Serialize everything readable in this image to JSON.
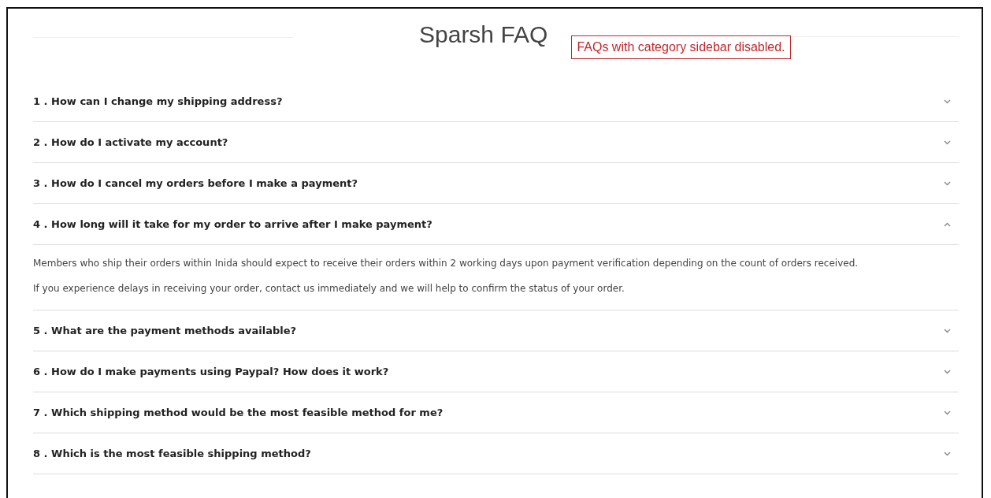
{
  "title": "Sparsh FAQ",
  "annotation": "FAQs with category sidebar disabled.",
  "faqs": [
    {
      "question": "1 . How can I change my shipping address?",
      "expanded": false
    },
    {
      "question": "2 . How do I activate my account?",
      "expanded": false
    },
    {
      "question": "3 . How do I cancel my orders before I make a payment?",
      "expanded": false
    },
    {
      "question": "4 . How long will it take for my order to arrive after I make payment?",
      "expanded": true,
      "answer": [
        "Members who ship their orders within Inida should expect to receive their orders within 2 working days upon payment verification depending on the count of orders received.",
        "If you experience delays in receiving your order, contact us immediately and we will help to confirm the status of your order."
      ]
    },
    {
      "question": "5 . What are the payment methods available?",
      "expanded": false
    },
    {
      "question": "6 . How do I make payments using Paypal? How does it work?",
      "expanded": false
    },
    {
      "question": "7 . Which shipping method would be the most feasible method for me?",
      "expanded": false
    },
    {
      "question": "8 . Which is the most feasible shipping method?",
      "expanded": false
    }
  ]
}
